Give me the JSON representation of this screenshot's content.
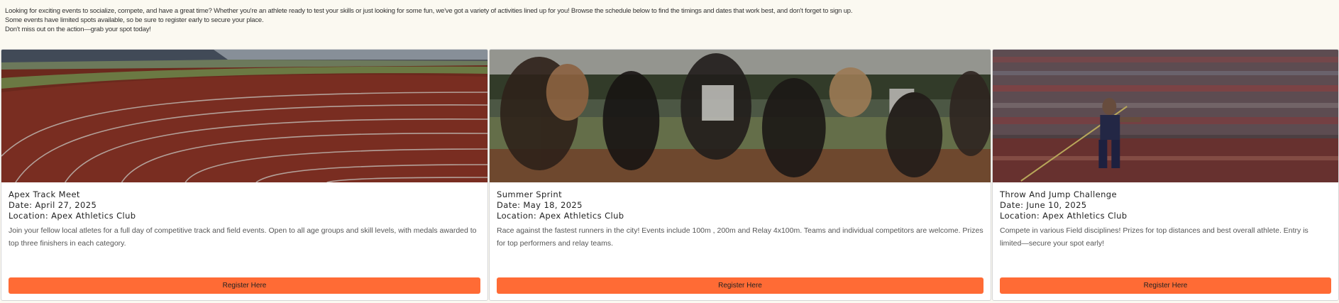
{
  "intro": {
    "line1": "Looking for exciting events to socialize, compete, and have a great time? Whether you're an athlete ready to test your skills or just looking for some fun, we've got a variety of activities lined up for you! Browse the schedule below to find the timings and dates that work best, and don't forget to sign up.",
    "line2": "Some events have limited spots available, so be sure to register early to secure your place.",
    "line3": "Don't miss out on the action—grab your spot today!"
  },
  "events": [
    {
      "title": "Apex Track Meet",
      "date": "Date: April 27, 2025",
      "location": "Location: Apex Athletics Club",
      "description": "Join your fellow local atletes for a full day of competitive track and field events. Open to all age groups and skill levels, with medals awarded to top three finishers in each category.",
      "button": "Register Here",
      "image_icon": "running-track-photo"
    },
    {
      "title": "Summer Sprint",
      "date": "Date: May 18, 2025",
      "location": "Location: Apex Athletics Club",
      "description": "Race against the fastest runners in the city! Events include 100m , 200m and Relay 4x100m. Teams and individual competitors are welcome. Prizes for top performers and relay teams.",
      "button": "Register Here",
      "image_icon": "sprinters-photo"
    },
    {
      "title": "Throw And Jump Challenge",
      "date": "Date: June 10, 2025",
      "location": "Location: Apex Athletics Club",
      "description": "Compete in various Field disciplines! Prizes for top distances and best overall athlete. Entry is limited—secure your spot early!",
      "button": "Register Here",
      "image_icon": "javelin-thrower-photo"
    }
  ],
  "colors": {
    "page_bg": "#fbf9f1",
    "button": "#ff6b35",
    "card_bg": "#ffffff"
  }
}
